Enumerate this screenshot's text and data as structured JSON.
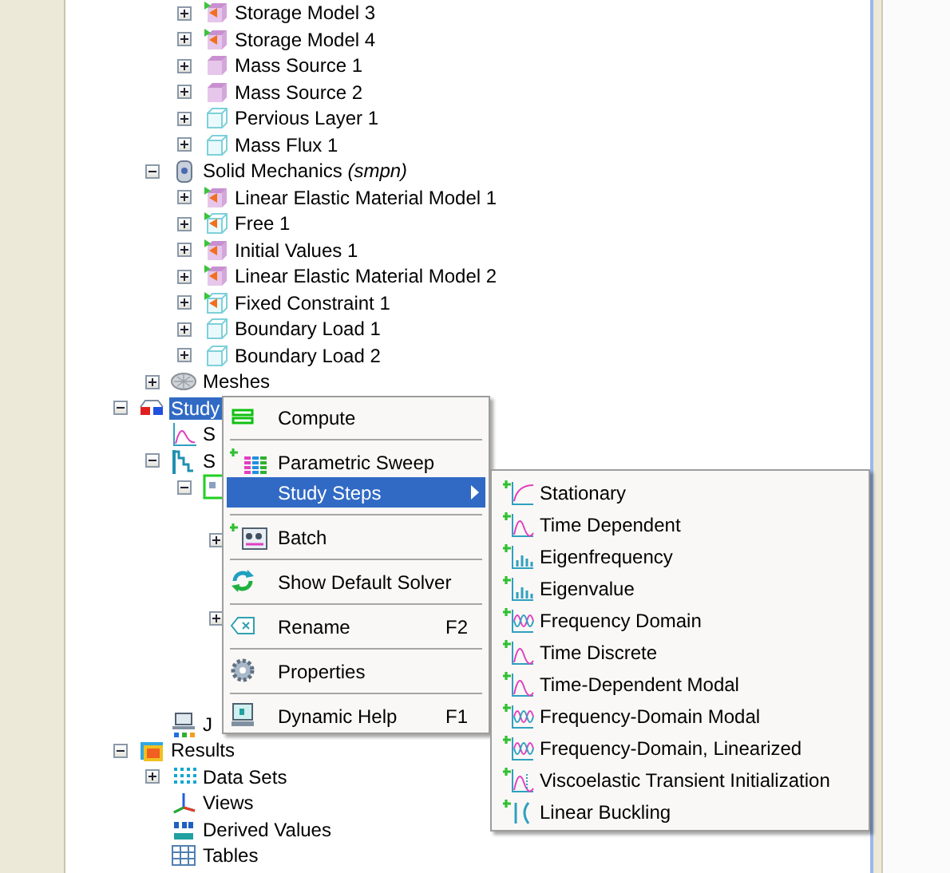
{
  "tree": [
    {
      "children": [
        {
          "children": [
            {
              "label": "Storage Model 3",
              "kind": "domain-flag",
              "expanded": false
            },
            {
              "label": "Storage Model 4",
              "kind": "domain-flag",
              "expanded": false
            },
            {
              "label": "Mass Source 1",
              "kind": "domain",
              "expanded": false
            },
            {
              "label": "Mass Source 2",
              "kind": "domain",
              "expanded": false
            },
            {
              "label": "Pervious Layer 1",
              "kind": "boundary",
              "expanded": false
            },
            {
              "label": "Mass Flux 1",
              "kind": "boundary",
              "expanded": false
            }
          ]
        },
        {
          "label": "Solid Mechanics *(smpn)*",
          "kind": "physics",
          "expanded": true,
          "children": [
            {
              "label": "Linear Elastic Material Model 1",
              "kind": "domain-flag",
              "expanded": false
            },
            {
              "label": "Free 1",
              "kind": "boundary-flag",
              "expanded": false
            },
            {
              "label": "Initial Values 1",
              "kind": "domain-flag",
              "expanded": false
            },
            {
              "label": "Linear Elastic Material Model 2",
              "kind": "domain-flag",
              "expanded": false
            },
            {
              "label": "Fixed Constraint 1",
              "kind": "boundary-flag",
              "expanded": false
            },
            {
              "label": "Boundary Load 1",
              "kind": "boundary",
              "expanded": false
            },
            {
              "label": "Boundary Load 2",
              "kind": "boundary",
              "expanded": false
            }
          ]
        },
        {
          "label": "Meshes",
          "kind": "mesh",
          "expanded": false
        }
      ]
    },
    {
      "label": "Study",
      "kind": "study",
      "expanded": true,
      "selected": true,
      "children": [
        {
          "label": "S",
          "kind": "step",
          "selected": false
        },
        {
          "label": "S",
          "kind": "solver",
          "expanded": true,
          "selected": false,
          "children": [
            {
              "kind": "config",
              "expanded": true,
              "children": [
                {
                  "expanded": false
                },
                {
                  "expanded": false
                }
              ]
            }
          ]
        },
        {
          "label": "J",
          "kind": "job",
          "selected": false
        }
      ]
    },
    {
      "label": "Results",
      "kind": "results",
      "expanded": true,
      "selected": false,
      "children": [
        {
          "label": "Data Sets",
          "kind": "datasets",
          "expanded": false,
          "selected": false
        },
        {
          "label": "Views",
          "kind": "views",
          "selected": false
        },
        {
          "label": "Derived Values",
          "kind": "derived",
          "selected": false
        },
        {
          "label": "Tables",
          "kind": "tables",
          "selected": false
        }
      ]
    }
  ],
  "context_menu": {
    "items": [
      {
        "kind": "command",
        "label": "Compute"
      },
      {
        "kind": "separator"
      },
      {
        "kind": "command",
        "label": "Parametric Sweep"
      },
      {
        "kind": "command",
        "label": "Study Steps",
        "selected": true,
        "submenu": true
      },
      {
        "kind": "separator"
      },
      {
        "kind": "command",
        "label": "Batch"
      },
      {
        "kind": "separator"
      },
      {
        "kind": "command",
        "label": "Show Default Solver"
      },
      {
        "kind": "separator"
      },
      {
        "kind": "command",
        "label": "Rename",
        "shortcut": "F2"
      },
      {
        "kind": "separator"
      },
      {
        "kind": "command",
        "label": "Properties"
      },
      {
        "kind": "separator"
      },
      {
        "kind": "command",
        "label": "Dynamic Help",
        "shortcut": "F1"
      }
    ]
  },
  "submenu": {
    "items": [
      {
        "label": "Stationary"
      },
      {
        "label": "Time Dependent"
      },
      {
        "label": "Eigenfrequency"
      },
      {
        "label": "Eigenvalue"
      },
      {
        "label": "Frequency Domain"
      },
      {
        "label": "Time Discrete"
      },
      {
        "label": "Time-Dependent Modal"
      },
      {
        "label": "Frequency-Domain Modal"
      },
      {
        "label": "Frequency-Domain, Linearized"
      },
      {
        "label": "Viscoelastic Transient Initialization"
      },
      {
        "label": "Linear Buckling"
      }
    ]
  }
}
